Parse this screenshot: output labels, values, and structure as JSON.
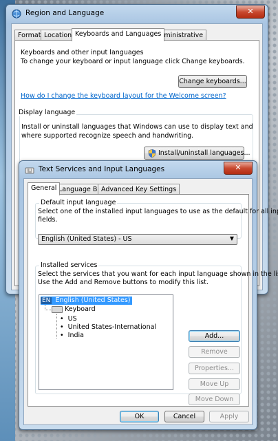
{
  "region_dialog": {
    "title": "Region and Language",
    "close_label": "✕",
    "tabs": [
      "Formats",
      "Location",
      "Keyboards and Languages",
      "Administrative"
    ],
    "keyboards_group": {
      "title": "Keyboards and other input languages",
      "description": "To change your keyboard or input language click Change keyboards.",
      "button": "Change keyboards...",
      "link": "How do I change the keyboard layout for the Welcome screen?"
    },
    "display_group": {
      "title": "Display language",
      "description_line1": "Install or uninstall languages that Windows can use to display text and",
      "description_line2": "where supported recognize speech and handwriting.",
      "button": "Install/uninstall languages..."
    }
  },
  "text_services_dialog": {
    "title": "Text Services and Input Languages",
    "close_label": "✕",
    "tabs": [
      "General",
      "Language Bar",
      "Advanced Key Settings"
    ],
    "default_group": {
      "title": "Default input language",
      "description_line1": "Select one of the installed input languages to use as the default for all input",
      "description_line2": "fields.",
      "selected_value": "English (United States) - US"
    },
    "installed_group": {
      "title": "Installed services",
      "description_line1": "Select the services that you want for each input language shown in the list.",
      "description_line2": "Use the Add and Remove buttons to modify this list.",
      "tree": {
        "language_code": "EN",
        "language": "English (United States)",
        "category": "Keyboard",
        "layouts": [
          "US",
          "United States-International",
          "India"
        ]
      },
      "buttons": {
        "add": "Add...",
        "remove": "Remove",
        "properties": "Properties...",
        "move_up": "Move Up",
        "move_down": "Move Down"
      }
    },
    "footer": {
      "ok": "OK",
      "cancel": "Cancel",
      "apply": "Apply"
    }
  },
  "colors": {
    "selection": "#3399ff",
    "link": "#0066cc",
    "frame_glass": "#a9c5e2"
  }
}
